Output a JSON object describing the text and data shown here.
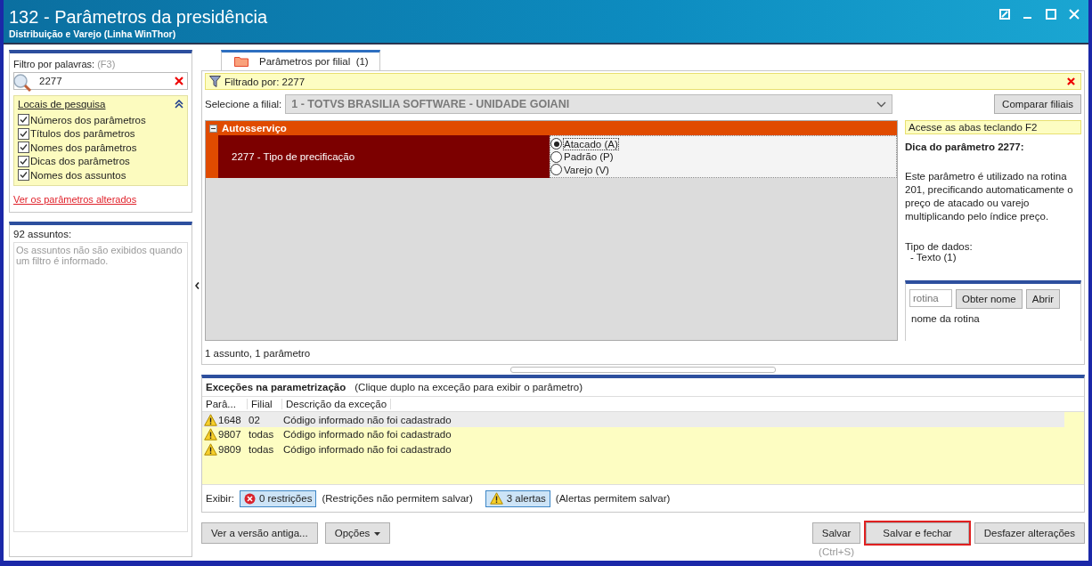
{
  "window": {
    "title": "132 - Parâmetros da presidência",
    "subtitle": "Distribuição e Varejo (Linha WinThor)"
  },
  "filter": {
    "label": "Filtro por palavras:",
    "shortcut": "(F3)",
    "value": "2277"
  },
  "search_places": {
    "title": "Locais de pesquisa",
    "expanded": true,
    "options": [
      {
        "label": "Números dos parâmetros",
        "checked": true
      },
      {
        "label": "Títulos dos parâmetros",
        "checked": true
      },
      {
        "label": "Nomes dos parâmetros",
        "checked": true
      },
      {
        "label": "Dicas dos parâmetros",
        "checked": true
      },
      {
        "label": "Nomes dos assuntos",
        "checked": true
      }
    ]
  },
  "changed_link": "Ver os parâmetros alterados",
  "subjects": {
    "title": "92 assuntos:",
    "message": "Os assuntos não são exibidos quando um filtro é informado."
  },
  "tabs": [
    {
      "label": "Parâmetros por filial",
      "count": "(1)",
      "selected": true
    }
  ],
  "filter_bar": {
    "text": "Filtrado por: 2277"
  },
  "branch": {
    "label": "Selecione a filial:",
    "value": "1 - TOTVS BRASILIA SOFTWARE - UNIDADE GOIANI",
    "disabled": true
  },
  "compare_button": "Comparar filiais",
  "group": {
    "title": "Autosserviço",
    "expanded": true,
    "parameters": [
      {
        "title": "2277 - Tipo de precificação",
        "options": [
          {
            "label": "Atacado (A)",
            "selected": true
          },
          {
            "label": "Padrão (P)",
            "selected": false
          },
          {
            "label": "Varejo (V)",
            "selected": false
          }
        ]
      }
    ]
  },
  "summary": "1 assunto, 1 parâmetro",
  "tip": {
    "hint": "Acesse as abas teclando F2",
    "title": "Dica do parâmetro 2277:",
    "body": "Este parâmetro é utilizado na rotina 201, precificando automaticamente o preço de atacado ou varejo multiplicando pelo índice preço.",
    "type_label": "Tipo de dados:",
    "type_value": "- Texto (1)"
  },
  "routine": {
    "placeholder": "rotina",
    "get_name": "Obter nome",
    "open": "Abrir",
    "name": "nome da rotina"
  },
  "exceptions": {
    "title": "Exceções na parametrização",
    "hint": "(Clique duplo na exceção para exibir o parâmetro)",
    "columns": [
      "Parâ...",
      "Filial",
      "Descrição da exceção"
    ],
    "rows": [
      {
        "param": "1648",
        "branch": "02",
        "description": "Código informado não foi cadastrado",
        "selected": true
      },
      {
        "param": "9807",
        "branch": "todas",
        "description": "Código informado não foi cadastrado",
        "selected": false
      },
      {
        "param": "9809",
        "branch": "todas",
        "description": "Código informado não foi cadastrado",
        "selected": false
      }
    ]
  },
  "show": {
    "label": "Exibir:",
    "restrictions": "0 restrições",
    "restrictions_note": "(Restrições não permitem salvar)",
    "alerts": "3 alertas",
    "alerts_note": "(Alertas permitem salvar)"
  },
  "left_buttons": [
    {
      "label": "Ver a versão antiga...",
      "kind": "plain"
    },
    {
      "label": "Opções",
      "kind": "menu"
    }
  ],
  "right_buttons": [
    {
      "label": "Salvar",
      "shortcut": "(Ctrl+S)",
      "highlighted": false
    },
    {
      "label": "Salvar e fechar",
      "highlighted": true
    },
    {
      "label": "Desfazer alterações",
      "highlighted": false
    }
  ]
}
